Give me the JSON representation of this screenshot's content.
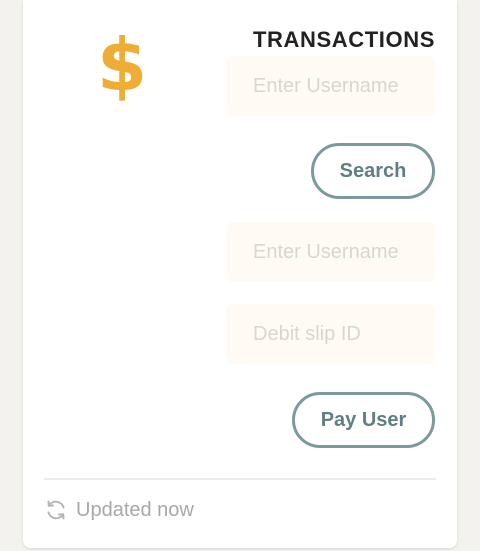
{
  "card": {
    "icon": "dollar-icon",
    "icon_glyph": "$",
    "icon_color": "#f0ad33",
    "title": "TRANSACTIONS"
  },
  "search_form": {
    "username_placeholder": "Enter Username",
    "username_value": "",
    "search_label": "Search"
  },
  "pay_form": {
    "username_placeholder": "Enter Username",
    "username_value": "",
    "debit_slip_placeholder": "Debit slip ID",
    "debit_slip_value": "",
    "pay_label": "Pay User"
  },
  "footer": {
    "icon": "refresh-icon",
    "status_text": "Updated now"
  },
  "colors": {
    "accent": "#7b9a9c",
    "field_bg": "#fffbf4",
    "page_bg": "#f3f2ee"
  }
}
